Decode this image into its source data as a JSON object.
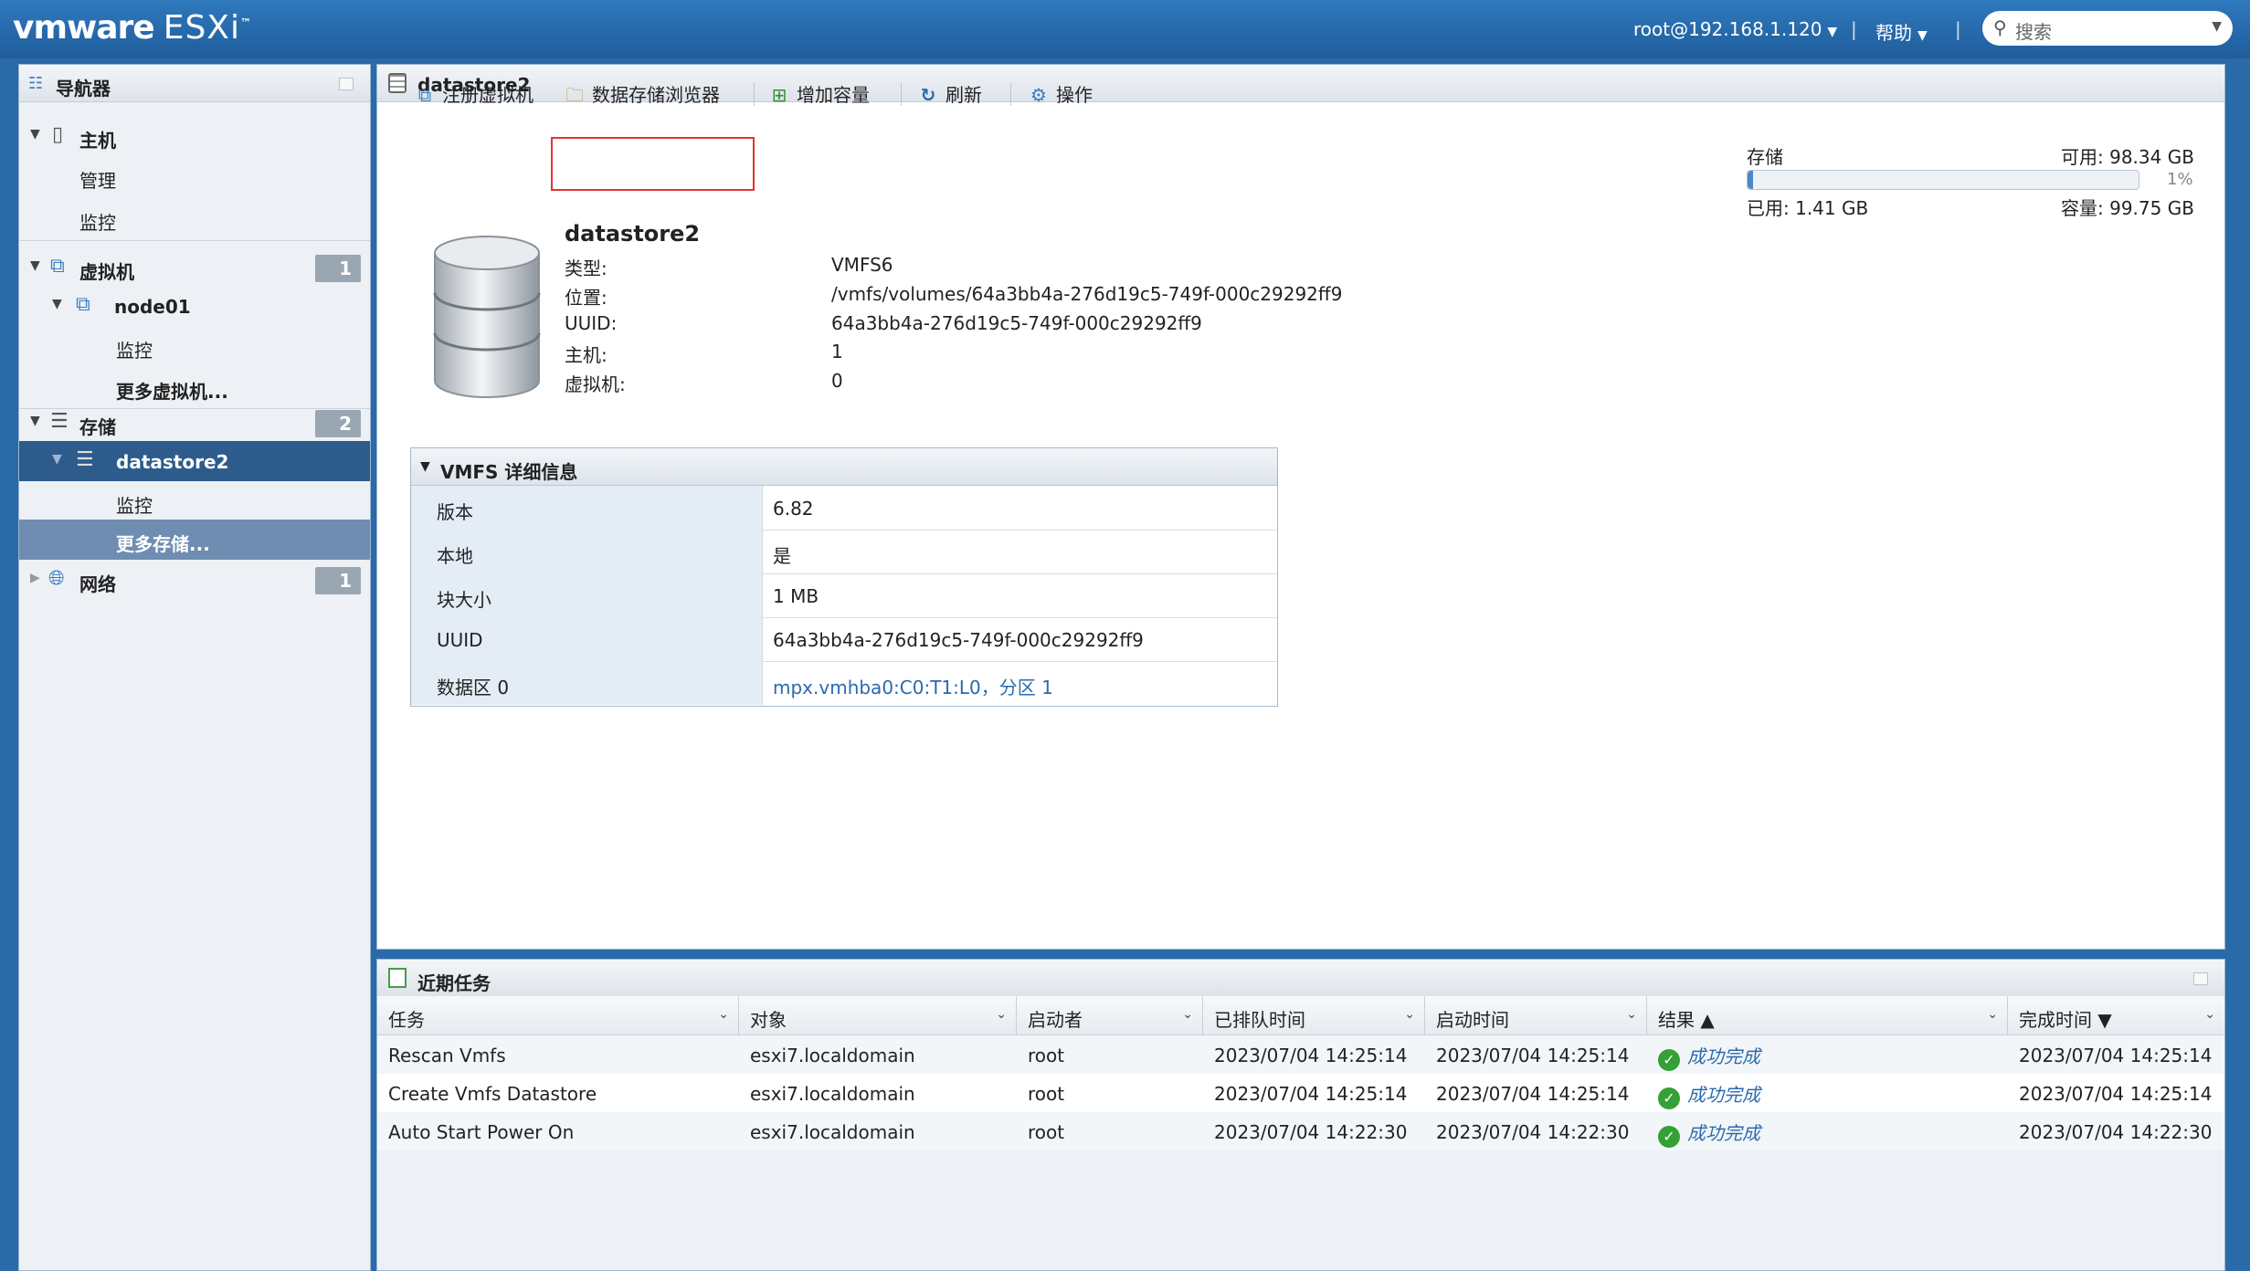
{
  "topbar": {
    "logo_vm": "vmware",
    "logo_product": "ESXi",
    "user": "root@192.168.1.120",
    "help": "帮助",
    "search_placeholder": "搜索"
  },
  "navigator": {
    "title": "导航器",
    "host": "主机",
    "host_manage": "管理",
    "host_monitor": "监控",
    "vms": "虚拟机",
    "vms_count": "1",
    "vm_node": "node01",
    "vm_node_monitor": "监控",
    "more_vms": "更多虚拟机...",
    "storage": "存储",
    "storage_count": "2",
    "datastore": "datastore2",
    "datastore_monitor": "监控",
    "more_storage": "更多存储...",
    "network": "网络",
    "network_count": "1"
  },
  "main": {
    "title": "datastore2",
    "toolbar": {
      "register_vm": "注册虚拟机",
      "datastore_browser": "数据存储浏览器",
      "increase_capacity": "增加容量",
      "refresh": "刷新",
      "actions": "操作"
    },
    "storage": {
      "label": "存储",
      "free": "可用: 98.34 GB",
      "percent": "1%",
      "used": "已用: 1.41 GB",
      "capacity": "容量: 99.75 GB",
      "used_fraction": 0.014
    },
    "summary": {
      "name": "datastore2",
      "rows": [
        {
          "k": "类型:",
          "v": "VMFS6"
        },
        {
          "k": "位置:",
          "v": "/vmfs/volumes/64a3bb4a-276d19c5-749f-000c29292ff9"
        },
        {
          "k": "UUID:",
          "v": "64a3bb4a-276d19c5-749f-000c29292ff9"
        },
        {
          "k": "主机:",
          "v": "1"
        },
        {
          "k": "虚拟机:",
          "v": "0"
        }
      ]
    },
    "vmfs": {
      "title": "VMFS 详细信息",
      "rows": [
        {
          "k": "版本",
          "v": "6.82"
        },
        {
          "k": "本地",
          "v": "是"
        },
        {
          "k": "块大小",
          "v": "1 MB"
        },
        {
          "k": "UUID",
          "v": "64a3bb4a-276d19c5-749f-000c29292ff9"
        },
        {
          "k": "数据区 0",
          "v": "mpx.vmhba0:C0:T1:L0，分区 1"
        }
      ]
    }
  },
  "tasks": {
    "title": "近期任务",
    "columns": [
      "任务",
      "对象",
      "启动者",
      "已排队时间",
      "启动时间",
      "结果 ▲",
      "完成时间 ▼"
    ],
    "rows": [
      [
        "Rescan Vmfs",
        "esxi7.localdomain",
        "root",
        "2023/07/04 14:25:14",
        "2023/07/04 14:25:14",
        "成功完成",
        "2023/07/04 14:25:14"
      ],
      [
        "Create Vmfs Datastore",
        "esxi7.localdomain",
        "root",
        "2023/07/04 14:25:14",
        "2023/07/04 14:25:14",
        "成功完成",
        "2023/07/04 14:25:14"
      ],
      [
        "Auto Start Power On",
        "esxi7.localdomain",
        "root",
        "2023/07/04 14:22:30",
        "2023/07/04 14:22:30",
        "成功完成",
        "2023/07/04 14:22:30"
      ]
    ]
  }
}
